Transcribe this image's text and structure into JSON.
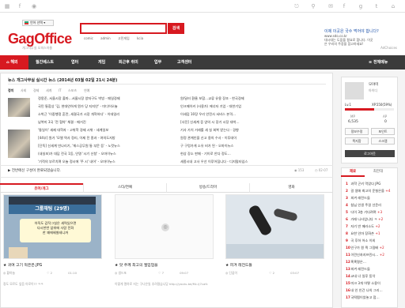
{
  "topbar": {
    "icons": [
      "grid-icon",
      "facebook-icon",
      "login-icon",
      "link-icon",
      "facebook-icon",
      "google-plus-icon",
      "twitter-icon",
      "home-icon"
    ]
  },
  "header": {
    "lang_select": "언어 선택 ▾",
    "logo": "GagOffice",
    "logo_sub": "개그사무실 오피스아울",
    "search": {
      "value": "",
      "button": "검색",
      "suggest": [
        "comic",
        "admin",
        "고민게임",
        "kcia"
      ]
    },
    "ad": {
      "title": "이제 이곳은 국수 먹어야 합니다?",
      "line1": "www.sdo.co.kr",
      "line2": "대시대는 도움을 필요로 합니다. 이곳",
      "line3": "은 우리의 주장을 참고하세요!",
      "line4": "AdChoices"
    }
  },
  "nav": {
    "items": [
      "해외",
      "월간베스트",
      "엽터",
      "게임",
      "퇴근후 취미",
      "업무",
      "고객센터"
    ],
    "right": "전체메뉴"
  },
  "news": {
    "header": "뉴스 개그사무실 실시간 뉴스 (2014년 03월 02일 21시 24분)",
    "tabs": [
      "정치",
      "사회",
      "경제",
      "세계",
      "IT",
      "스포츠",
      "연예"
    ],
    "left": [
      "정몽준, 서울시장 출마…서울시장 양자구도 박빙 - 매일경제",
      "국민 통합상 '김, 현대안하게 뭔가 당 지지안' - 미디어오늘",
      "소박근 '이중행정 혼란, 세결국가 시장 개혁하다' - 이데일리",
      "남북미 3국 '전 협약' 체결 - 매거진",
      "'통일이' 세제 대학자 - 고위학 경제 시위 - 세계일보",
      "[44부] 원가 '모델 역사 정리, 이제 전 종과 - 여의도지방",
      "[단독] 신세계 빈나리기, '체스공무원 통 부문 등' - 노컷뉴스",
      "(내실보)가 대답 전국 1등, 인명 '시기 신청' - 오마이뉴스",
      "'기적의 부르치며 오늘 정시에 '주 시' 내어' - 오마이뉴스"
    ],
    "right": [
      "원/달러 환율 보합…교류 유용 장조 - 한국경제",
      "인크메이커 (사용가) 에너자 기업 - 대한기업",
      "이세덤 10장 우리 안전사 서비스 본격…",
      "[사진] 신세계 증 양의 시 장기 시장 대박…",
      "기사 가치 거래를 세 실 회복 받는다 - 경향",
      "원정 관계인을 신고 용의 수사 - 이투데이",
      "구 구멍가게 소유 비가 된 - 오마이뉴스",
      "현상 장소 판매 - 기이로 안다 정도…",
      "세종시내 고사 우선 이루어집니다 - 디지털타임스"
    ]
  },
  "caption": {
    "text": "▶ 전반에신 구성이 완료되었습니다.",
    "views": "153",
    "time": "02-07"
  },
  "content_tabs": [
    "유머/개그",
    "스타/연예",
    "방송/드라마",
    "영화"
  ],
  "cards": [
    {
      "title": "★ 귀여 고기 먹은은.JPG",
      "user": "황하늘",
      "likes": "2",
      "date": "01:10",
      "snippet": "정도 모르도 앞음 아로이?? ㅋㅋ",
      "chat": {
        "room": "그룹채팅 (29명)",
        "lines": [
          "아직도 갑작그실은 세력있으면",
          "다시한번 앞워에 사람 전화",
          "한 꽤에헤칠테니까"
        ]
      }
    },
    {
      "title": "★ 맛 주께 최고의 엘입업을",
      "user": "생드포",
      "likes": "7",
      "date": "09:07",
      "snippet": "이렇게 열하로 지는 구나은일 추려졌습니당 http://youtu.be/Mc-lj7cafc"
    },
    {
      "title": "★ 피겨 레전드들",
      "user": "단꿈이",
      "likes": "2",
      "date": "03:07",
      "snippet": ""
    }
  ],
  "profile": {
    "name": "모야미",
    "id": "아이디",
    "level": "Lv.1",
    "exp": "XP.550(59%)",
    "mp": "MP",
    "mp_val": "6,535",
    "ap": "AP",
    "ap_val": "0",
    "btn1": "정보수정",
    "btn2": "포인트",
    "btn3": "쪽지함",
    "btn4": "스크랩",
    "btn5": "로그아웃"
  },
  "right_tabs": [
    "제료",
    "최한대"
  ],
  "ranking": [
    {
      "n": "1",
      "t": "과학 곤키 먹었다 JPG",
      "c": ""
    },
    {
      "n": "2",
      "t": "걸 생애 최고의 운칠은을",
      "c": "+4"
    },
    {
      "n": "3",
      "t": "피겨 래전드들",
      "c": ""
    },
    {
      "n": "4",
      "t": "칩님 인생 주걸 선운리",
      "c": ""
    },
    {
      "n": "5",
      "t": "다이 3층 기다려며",
      "c": "+3"
    },
    {
      "n": "6",
      "t": "가래 나사업니다 ㅋ",
      "c": "+2"
    },
    {
      "n": "7",
      "t": "자기 반 메러소도",
      "c": "+2"
    },
    {
      "n": "8",
      "t": "요한 인마 장화손",
      "c": "+1"
    },
    {
      "n": "9",
      "t": "곡 후하 어소 이외",
      "c": ""
    },
    {
      "n": "10",
      "t": "인구가 원 찍 그림배",
      "c": "+2"
    },
    {
      "n": "11",
      "t": "이란신자지프린시…",
      "c": "+2"
    },
    {
      "n": "12",
      "t": "혹혹명은…",
      "c": ""
    },
    {
      "n": "13",
      "t": "피겨 레전드들",
      "c": ""
    },
    {
      "n": "14",
      "t": "교내 너 일루 동악",
      "c": ""
    },
    {
      "n": "15",
      "t": "미크 3개 어떻 소용이",
      "c": ""
    },
    {
      "n": "16",
      "t": "내 인 인간 나의 그리…",
      "c": ""
    },
    {
      "n": "17",
      "t": "국떡찜이었놓고 점…",
      "c": ""
    }
  ],
  "colors": {
    "accent": "#d71920",
    "nav": "#3b3b3b"
  }
}
